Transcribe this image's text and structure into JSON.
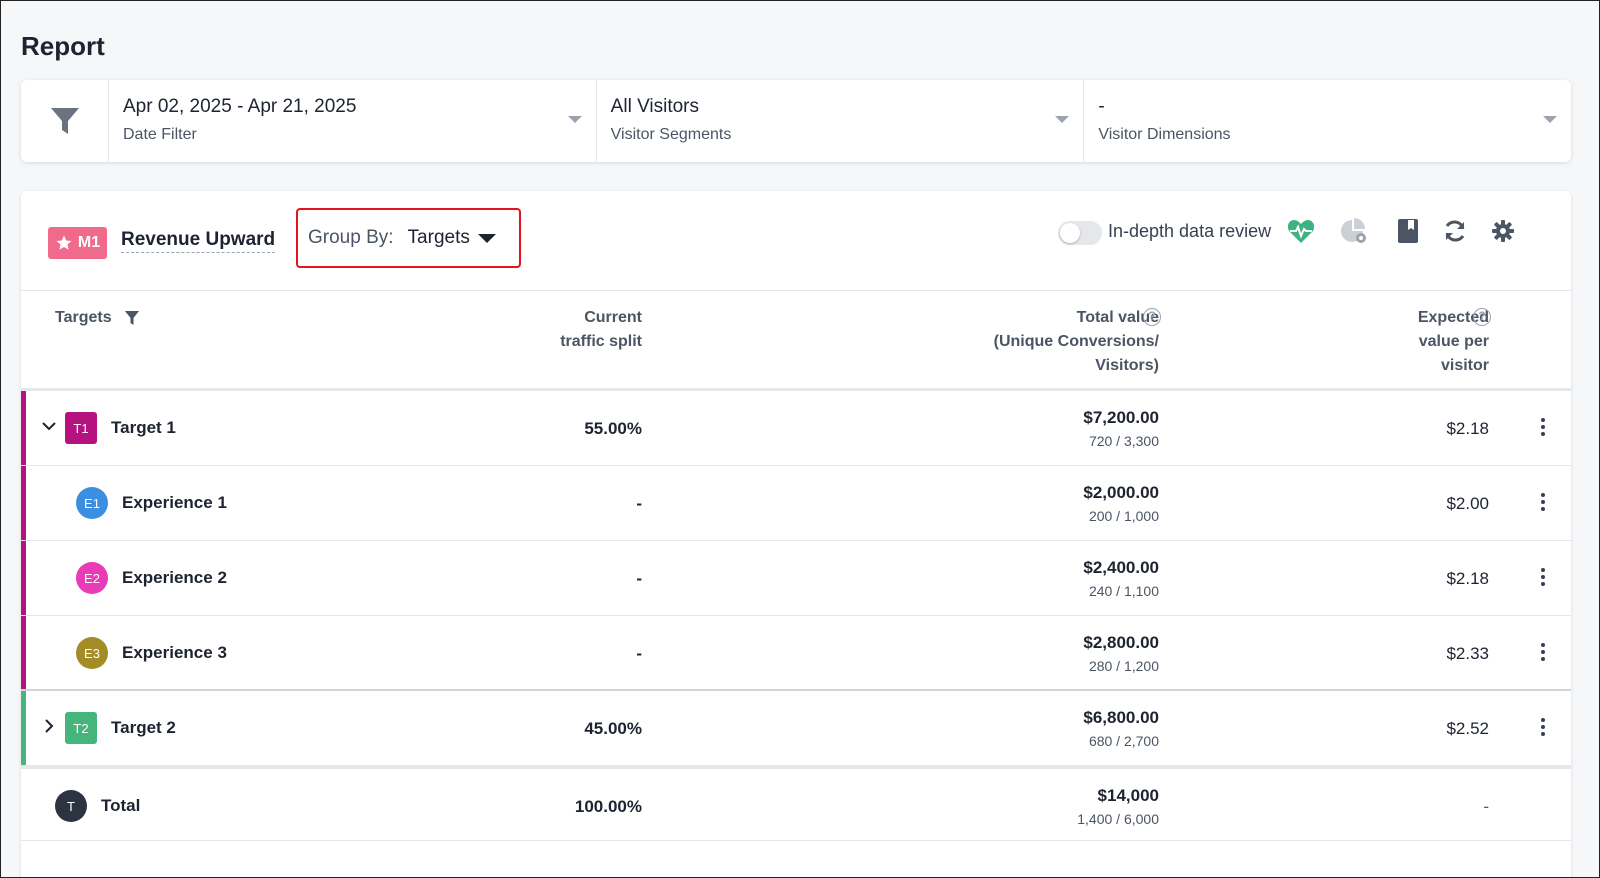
{
  "page": {
    "title": "Report"
  },
  "filters": {
    "date": {
      "value": "Apr 02, 2025 - Apr 21, 2025",
      "label": "Date Filter"
    },
    "segments": {
      "value": "All Visitors",
      "label": "Visitor Segments"
    },
    "dimensions": {
      "value": "-",
      "label": "Visitor Dimensions"
    }
  },
  "metric": {
    "badge_label": "M1",
    "badge_color": "#f06a8c",
    "name": "Revenue Upward"
  },
  "group_by": {
    "label": "Group By:",
    "value": "Targets"
  },
  "toolbar": {
    "toggle_label": "In-depth data review",
    "toggle_on": false,
    "icons": [
      "heartbeat-icon",
      "pie-settings-icon",
      "bookmark-icon",
      "refresh-icon",
      "gear-icon"
    ]
  },
  "table": {
    "headers": {
      "targets": "Targets",
      "split_line1": "Current",
      "split_line2": "traffic split",
      "total_line1": "Total value",
      "total_line2": "(Unique Conversions/",
      "total_line3": "Visitors)",
      "expected_line1": "Expected",
      "expected_line2": "value per",
      "expected_line3": "visitor",
      "help_glyph": "?"
    },
    "targets": [
      {
        "badge": "T1",
        "color": "#b5117f",
        "name": "Target 1",
        "split": "55.00%",
        "total": "$7,200.00",
        "sub": "720 / 3,300",
        "expected": "$2.18",
        "expanded": true,
        "experiences": [
          {
            "badge": "E1",
            "color": "#3b8fe0",
            "name": "Experience 1",
            "split": "-",
            "total": "$2,000.00",
            "sub": "200 / 1,000",
            "expected": "$2.00"
          },
          {
            "badge": "E2",
            "color": "#e93bb5",
            "name": "Experience 2",
            "split": "-",
            "total": "$2,400.00",
            "sub": "240 / 1,100",
            "expected": "$2.18"
          },
          {
            "badge": "E3",
            "color": "#a38b25",
            "name": "Experience 3",
            "split": "-",
            "total": "$2,800.00",
            "sub": "280 / 1,200",
            "expected": "$2.33"
          }
        ]
      },
      {
        "badge": "T2",
        "color": "#46b57b",
        "name": "Target 2",
        "split": "45.00%",
        "total": "$6,800.00",
        "sub": "680 / 2,700",
        "expected": "$2.52",
        "expanded": false,
        "experiences": []
      }
    ],
    "total": {
      "badge": "T",
      "color": "#2b3440",
      "name": "Total",
      "split": "100.00%",
      "total": "$14,000",
      "sub": "1,400 / 6,000",
      "expected": "-"
    }
  }
}
